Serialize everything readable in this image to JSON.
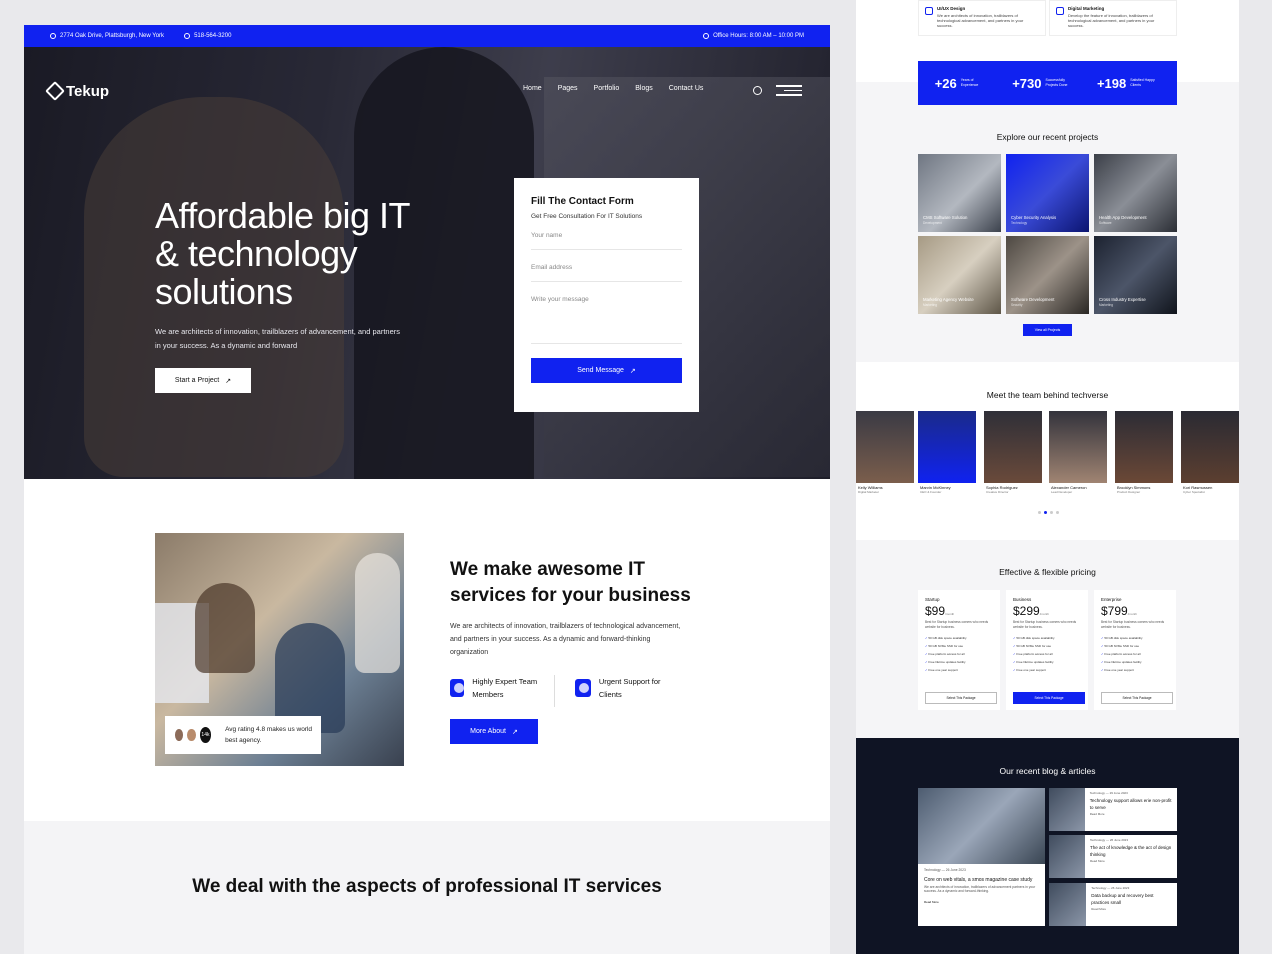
{
  "topbar": {
    "address": "2774 Oak Drive, Plattsburgh, New York",
    "phone": "518-564-3200",
    "hours": "Office Hours: 8:00 AM – 10:00 PM"
  },
  "brand": {
    "name": "Tekup",
    "accent": "#1022f0"
  },
  "nav": {
    "links": [
      "Home",
      "Pages",
      "Portfolio",
      "Blogs",
      "Contact Us"
    ]
  },
  "hero": {
    "title": "Affordable big IT & technology solutions",
    "text": "We are architects of innovation, trailblazers of advancement, and partners in your success. As a dynamic and forward",
    "button": "Start a Project"
  },
  "form": {
    "title": "Fill The Contact Form",
    "subtitle": "Get Free Consultation For IT Solutions",
    "name_placeholder": "Your name",
    "email_placeholder": "Email address",
    "message_placeholder": "Write your message",
    "button": "Send Message"
  },
  "about": {
    "title": "We make awesome IT services for your business",
    "text": "We are architects of innovation, trailblazers of technological advancement, and partners in your success. As a dynamic and forward-thinking organization",
    "feature1": "Highly Expert Team Members",
    "feature2": "Urgent Support for Clients",
    "button": "More About",
    "rating_count": "14k",
    "rating_text": "Avg rating 4.8 makes us world best agency."
  },
  "deal": {
    "title": "We deal with the aspects of professional IT services"
  },
  "services": [
    {
      "title": "UI/UX Design",
      "text": "We are architects of innovation, trailblazers of technological advancement, and partners in your success."
    },
    {
      "title": "Digital Marketing",
      "text": "Develop the feature of innovation, trailblazers of technological advancement, and partners in your success."
    }
  ],
  "stats": [
    {
      "value": "+26",
      "label": "Years of Experience"
    },
    {
      "value": "+730",
      "label": "Successfully Projects Done"
    },
    {
      "value": "+198",
      "label": "Satisfied Happy Clients"
    }
  ],
  "projects": {
    "title": "Explore our recent projects",
    "items": [
      {
        "name": "CMS Software Solution",
        "cat": "Development"
      },
      {
        "name": "Cyber Security Analysis",
        "cat": "Technology"
      },
      {
        "name": "Health App Development",
        "cat": "Software"
      },
      {
        "name": "Marketing Agency Website",
        "cat": "Marketing"
      },
      {
        "name": "Software Development",
        "cat": "Security"
      },
      {
        "name": "Cross Industry Expertise",
        "cat": "Marketing"
      }
    ],
    "view_all": "View all Projects"
  },
  "team": {
    "title": "Meet the team behind techverse",
    "members": [
      {
        "name": "Kelly Williams",
        "role": "Digital Marketer"
      },
      {
        "name": "Marvin McKinney",
        "role": "CEO & Founder"
      },
      {
        "name": "Sophia Rodriguez",
        "role": "Creative Director"
      },
      {
        "name": "Alexander Cameron",
        "role": "Lead Developer"
      },
      {
        "name": "Brooklyn Simmons",
        "role": "Product Designer"
      },
      {
        "name": "Kori Rasmussen",
        "role": "Cyber Specialist"
      }
    ]
  },
  "pricing": {
    "title": "Effective & flexible pricing",
    "plans": [
      {
        "name": "Startup",
        "price": "$99",
        "per": "/month",
        "desc": "Best for Startup business owners who needs website for business.",
        "button": "Select This Package"
      },
      {
        "name": "Business",
        "price": "$299",
        "per": "/month",
        "desc": "Best for Startup business owners who needs website for business.",
        "button": "Select This Package"
      },
      {
        "name": "Enterprise",
        "price": "$799",
        "per": "/month",
        "desc": "Best for Startup business owners who needs website for business.",
        "button": "Select This Package"
      }
    ],
    "features": [
      "50 GB disk space availability",
      "50 GB NVMe SSD for use",
      "Free platform access for all",
      "Free lifetime updates facility",
      "Free one year support"
    ]
  },
  "blog": {
    "title": "Our recent blog & articles",
    "main": {
      "meta": "Technology — 26 June 2023",
      "title": "Core on web vitals, a smos magazine case study",
      "text": "We are architects of innovation, trailblazers of advancement partners in your success. As a dynamic and forward-thinking.",
      "more": "Read More"
    },
    "posts": [
      {
        "meta": "Technology — 29 June 2023",
        "title": "Technology support allows erie non-profit to serve",
        "more": "Read More"
      },
      {
        "meta": "Technology — 26 June 2023",
        "title": "The act of knowledge & the act of design thinking",
        "more": "Read More"
      },
      {
        "meta": "Technology — 26 June 2023",
        "title": "Data backup and recovery best practices small",
        "more": "Read More"
      }
    ]
  }
}
